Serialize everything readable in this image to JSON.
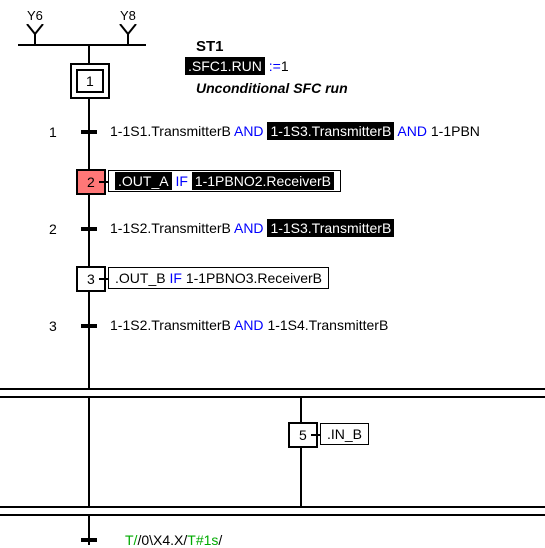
{
  "ylabels": {
    "y6": "Y6",
    "y8": "Y8"
  },
  "header": {
    "title": "ST1",
    "assign_target": ".SFC1.RUN",
    "assign_op": ":=",
    "assign_val": "1",
    "comment": "Unconditional SFC run"
  },
  "steps": {
    "s1": "1",
    "s2": "2",
    "s3": "3",
    "s5": "5"
  },
  "transitions": {
    "t1": "1",
    "t2": "2",
    "t3": "3"
  },
  "actions": {
    "a2_out": ".OUT_A",
    "a2_if": "IF",
    "a2_cond": "1-1PBNO2.ReceiverB",
    "a3_out": ".OUT_B",
    "a3_if": "IF",
    "a3_cond": "1-1PBNO3.ReceiverB",
    "a5": ".IN_B"
  },
  "conds": {
    "c1_a": "1-1S1.TransmitterB",
    "c1_and": "AND",
    "c1_b": "1-1S3.TransmitterB",
    "c1_and2": "AND",
    "c1_c": "1-1PBN",
    "c2_a": "1-1S2.TransmitterB",
    "c2_and": "AND",
    "c2_b": "1-1S3.TransmitterB",
    "c3_a": "1-1S2.TransmitterB",
    "c3_and": "AND",
    "c3_b": "1-1S4.TransmitterB"
  },
  "bottom": {
    "t_prefix": "T/",
    "t_mid": "/0\\X4.X/",
    "t_suffix": "T#1s",
    "t_slash": "/"
  }
}
